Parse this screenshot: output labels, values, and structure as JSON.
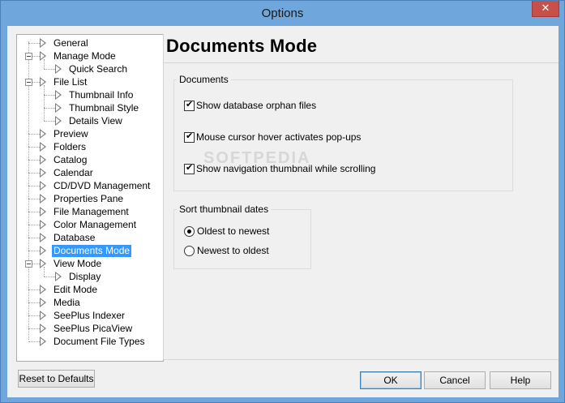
{
  "window": {
    "title": "Options",
    "close_glyph": "✕"
  },
  "tree": {
    "items": [
      {
        "label": "General"
      },
      {
        "label": "Manage Mode"
      },
      {
        "label": "Quick Search"
      },
      {
        "label": "File List"
      },
      {
        "label": "Thumbnail Info"
      },
      {
        "label": "Thumbnail Style"
      },
      {
        "label": "Details View"
      },
      {
        "label": "Preview"
      },
      {
        "label": "Folders"
      },
      {
        "label": "Catalog"
      },
      {
        "label": "Calendar"
      },
      {
        "label": "CD/DVD Management"
      },
      {
        "label": "Properties Pane"
      },
      {
        "label": "File Management"
      },
      {
        "label": "Color Management"
      },
      {
        "label": "Database"
      },
      {
        "label": "Documents Mode",
        "selected": true
      },
      {
        "label": "View Mode"
      },
      {
        "label": "Display"
      },
      {
        "label": "Edit Mode"
      },
      {
        "label": "Media"
      },
      {
        "label": "SeePlus Indexer"
      },
      {
        "label": "SeePlus PicaView"
      },
      {
        "label": "Document File Types"
      }
    ]
  },
  "main": {
    "title": "Documents Mode",
    "documents_group": {
      "label": "Documents",
      "options": [
        {
          "label": "Show database orphan files",
          "checked": true
        },
        {
          "label": "Mouse cursor hover activates pop-ups",
          "checked": true
        },
        {
          "label": "Show navigation thumbnail while scrolling",
          "checked": true
        }
      ]
    },
    "sort_group": {
      "label": "Sort thumbnail dates",
      "options": [
        {
          "label": "Oldest to newest",
          "selected": true
        },
        {
          "label": "Newest to oldest",
          "selected": false
        }
      ]
    },
    "watermark": "SOFTPEDIA"
  },
  "buttons": {
    "reset": "Reset to Defaults",
    "ok": "OK",
    "cancel": "Cancel",
    "help": "Help"
  },
  "colors": {
    "selection": "#3399ff",
    "titlebar": "#6fa6dc",
    "close": "#c7504a"
  }
}
